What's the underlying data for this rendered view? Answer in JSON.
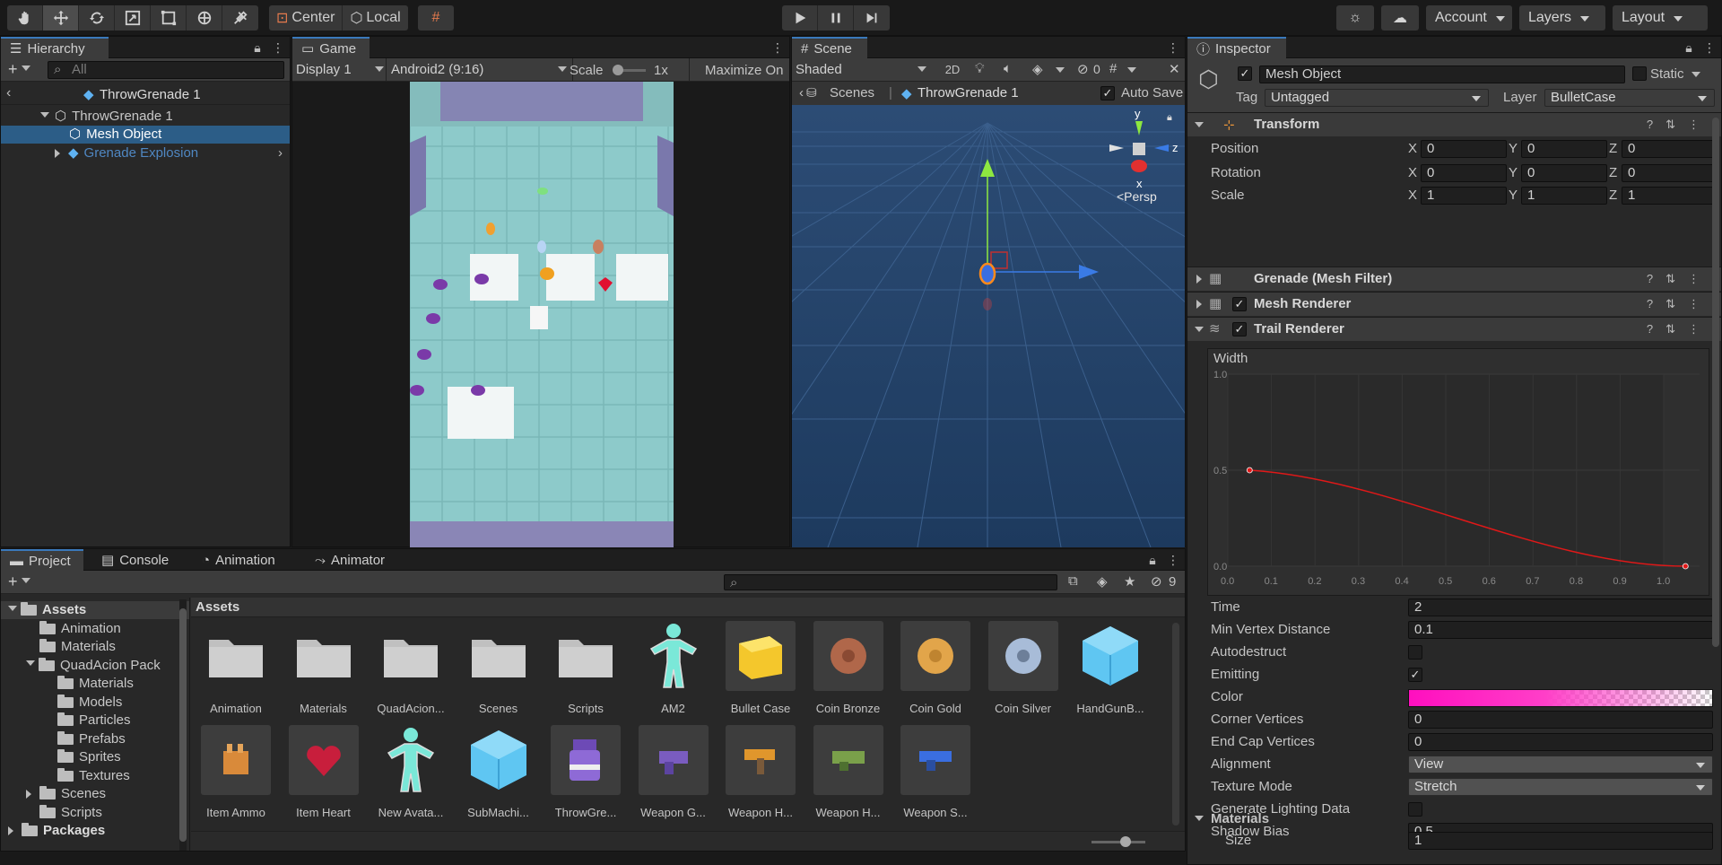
{
  "toolbar": {
    "center_label": "Center",
    "local_label": "Local",
    "account_label": "Account",
    "layers_label": "Layers",
    "layout_label": "Layout"
  },
  "hierarchy": {
    "tab_label": "Hierarchy",
    "search_placeholder": "All",
    "scene_title": "ThrowGrenade 1",
    "items": [
      {
        "label": "ThrowGrenade 1"
      },
      {
        "label": "Mesh Object"
      },
      {
        "label": "Grenade Explosion"
      }
    ]
  },
  "game": {
    "tab_label": "Game",
    "display": "Display 1",
    "resolution": "Android2 (9:16)",
    "scale_label": "Scale",
    "scale_value": "1x",
    "maximize_label": "Maximize On"
  },
  "scene": {
    "tab_label": "Scene",
    "shading": "Shaded",
    "mode_2d": "2D",
    "hidden_count": "0",
    "breadcrumb_root": "Scenes",
    "breadcrumb_item": "ThrowGrenade 1",
    "auto_save_label": "Auto Save",
    "gizmo_y": "y",
    "gizmo_x": "x",
    "gizmo_z": "z",
    "persp_label": "<Persp"
  },
  "inspector": {
    "tab_label": "Inspector",
    "object_name": "Mesh Object",
    "static_label": "Static",
    "tag_label": "Tag",
    "tag_value": "Untagged",
    "layer_label": "Layer",
    "layer_value": "BulletCase",
    "transform": {
      "title": "Transform",
      "position_label": "Position",
      "rotation_label": "Rotation",
      "scale_label": "Scale",
      "x": "X",
      "y": "Y",
      "z": "Z",
      "position": [
        "0",
        "0",
        "0"
      ],
      "rotation": [
        "0",
        "0",
        "0"
      ],
      "scale": [
        "1",
        "1",
        "1"
      ]
    },
    "mesh_filter_title": "Grenade (Mesh Filter)",
    "mesh_renderer_title": "Mesh Renderer",
    "trail_renderer_title": "Trail Renderer",
    "curve": {
      "label": "Width",
      "y_ticks": [
        "1.0",
        "0.5",
        "0.0"
      ],
      "x_ticks": [
        "0.0",
        "0.1",
        "0.2",
        "0.3",
        "0.4",
        "0.5",
        "0.6",
        "0.7",
        "0.8",
        "0.9",
        "1.0"
      ],
      "color": "#e01818"
    },
    "props": [
      {
        "label": "Time",
        "value": "2",
        "kind": "field"
      },
      {
        "label": "Min Vertex Distance",
        "value": "0.1",
        "kind": "field"
      },
      {
        "label": "Autodestruct",
        "value": "",
        "kind": "check"
      },
      {
        "label": "Emitting",
        "value": "✓",
        "kind": "check"
      },
      {
        "label": "Color",
        "value": "",
        "kind": "gradient"
      },
      {
        "label": "Corner Vertices",
        "value": "0",
        "kind": "field"
      },
      {
        "label": "End Cap Vertices",
        "value": "0",
        "kind": "field"
      },
      {
        "label": "Alignment",
        "value": "View",
        "kind": "dropdown"
      },
      {
        "label": "Texture Mode",
        "value": "Stretch",
        "kind": "dropdown"
      },
      {
        "label": "Generate Lighting Data",
        "value": "",
        "kind": "check"
      },
      {
        "label": "Shadow Bias",
        "value": "0.5",
        "kind": "field"
      }
    ],
    "materials_label": "Materials",
    "size_label": "Size",
    "size_value": "1"
  },
  "bottom": {
    "tabs": [
      "Project",
      "Console",
      "Animation",
      "Animator"
    ],
    "hidden_count": "9",
    "assets_header": "Assets",
    "tree": [
      {
        "label": "Assets",
        "depth": 0,
        "bold": true
      },
      {
        "label": "Animation",
        "depth": 1
      },
      {
        "label": "Materials",
        "depth": 1
      },
      {
        "label": "QuadAcion Pack",
        "depth": 1
      },
      {
        "label": "Materials",
        "depth": 2
      },
      {
        "label": "Models",
        "depth": 2
      },
      {
        "label": "Particles",
        "depth": 2
      },
      {
        "label": "Prefabs",
        "depth": 2
      },
      {
        "label": "Sprites",
        "depth": 2
      },
      {
        "label": "Textures",
        "depth": 2
      },
      {
        "label": "Scenes",
        "depth": 1
      },
      {
        "label": "Scripts",
        "depth": 1
      },
      {
        "label": "Packages",
        "depth": 0,
        "bold": true
      }
    ],
    "assets_row1": [
      "Animation",
      "Materials",
      "QuadAcion...",
      "Scenes",
      "Scripts",
      "AM2",
      "Bullet Case",
      "Coin Bronze",
      "Coin Gold",
      "Coin Silver",
      "HandGunB..."
    ],
    "assets_row2": [
      "Item Ammo",
      "Item Heart",
      "New Avata...",
      "SubMachi...",
      "ThrowGre...",
      "Weapon G...",
      "Weapon H...",
      "Weapon H...",
      "Weapon S..."
    ]
  }
}
